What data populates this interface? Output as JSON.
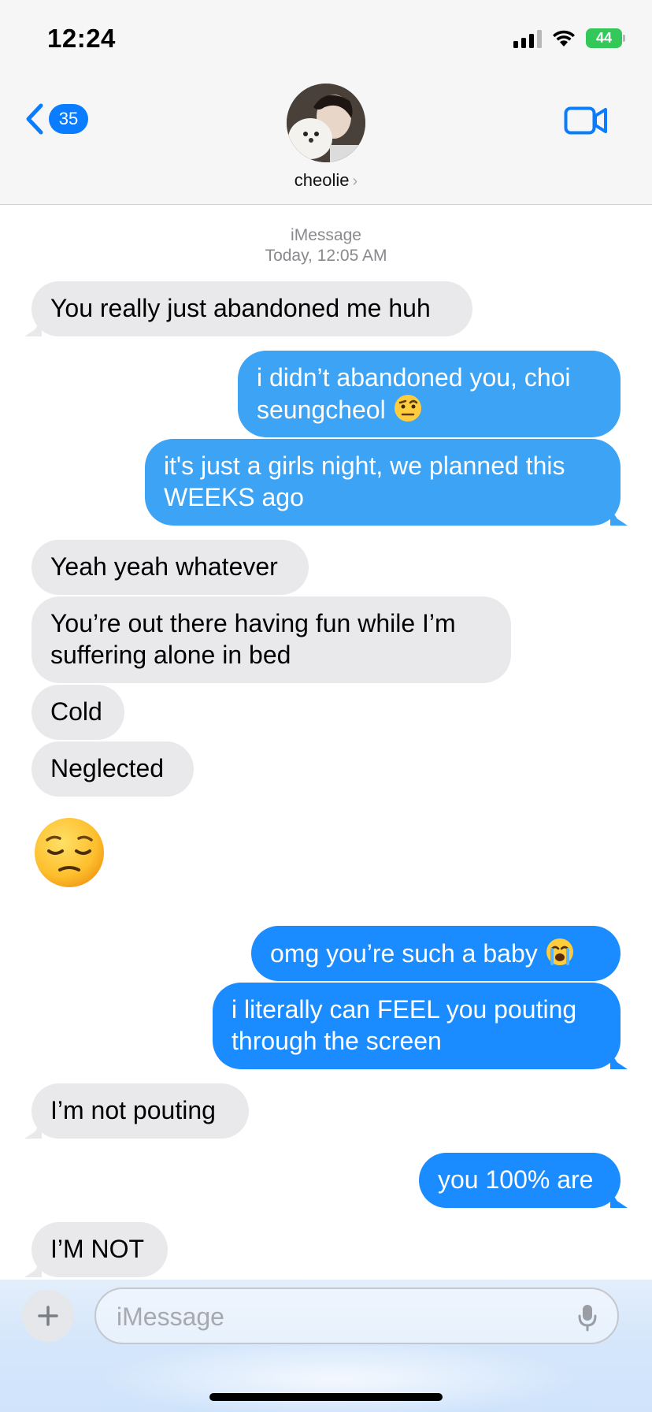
{
  "status_bar": {
    "time": "12:24",
    "battery": "44",
    "icons": [
      "signal-icon",
      "wifi-icon",
      "battery-icon"
    ]
  },
  "header": {
    "back_count": "35",
    "contact_name": "cheolie",
    "icons": [
      "back-chevron-icon",
      "video-camera-icon",
      "chevron-right-icon"
    ]
  },
  "thread": {
    "service": "iMessage",
    "timestamp": "Today, 12:05 AM"
  },
  "messages": [
    {
      "side": "received",
      "text": "You really just abandoned me huh"
    },
    {
      "side": "sent",
      "text": "i didn’t abandoned you, choi seungcheol",
      "emoji": "🤨"
    },
    {
      "side": "sent",
      "text": "it's just a girls night, we planned this WEEKS ago"
    },
    {
      "side": "received",
      "text": "Yeah yeah whatever"
    },
    {
      "side": "received",
      "text": "You’re out there having fun while I’m suffering alone in bed"
    },
    {
      "side": "received",
      "text": "Cold"
    },
    {
      "side": "received",
      "text": "Neglected"
    },
    {
      "side": "received",
      "emoji": "pensive-face-emoji"
    },
    {
      "side": "sent",
      "text": "omg you’re such a baby",
      "emoji": "😭"
    },
    {
      "side": "sent",
      "text": "i literally can FEEL you pouting through the screen"
    },
    {
      "side": "received",
      "text": "I’m not pouting"
    },
    {
      "side": "sent",
      "text": "you 100% are"
    },
    {
      "side": "received",
      "text": "I’M NOT"
    }
  ],
  "compose": {
    "placeholder": "iMessage",
    "icons": [
      "plus-icon",
      "microphone-icon"
    ]
  },
  "colors": {
    "sent_bubble": "#1a8cff",
    "sent_bubble_light": "#3da3f5",
    "received_bubble": "#e9e9eb",
    "accent": "#0a7cff",
    "battery": "#34c759"
  }
}
